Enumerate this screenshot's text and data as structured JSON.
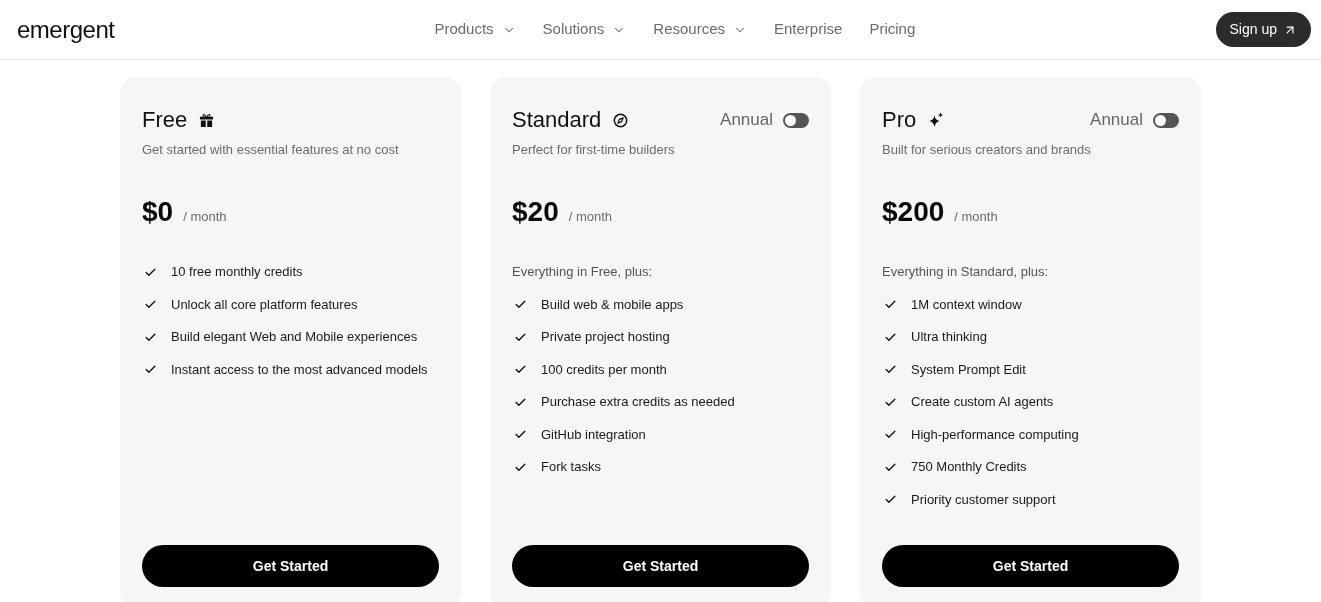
{
  "header": {
    "logo": "emergent",
    "nav": [
      {
        "label": "Products",
        "dropdown": true
      },
      {
        "label": "Solutions",
        "dropdown": true
      },
      {
        "label": "Resources",
        "dropdown": true
      },
      {
        "label": "Enterprise",
        "dropdown": false
      },
      {
        "label": "Pricing",
        "dropdown": false
      }
    ],
    "signup": "Sign up"
  },
  "plans": [
    {
      "name": "Free",
      "description": "Get started with essential features at no cost",
      "price": "$0",
      "period": "/ month",
      "features": [
        "10 free monthly credits",
        "Unlock all core platform features",
        "Build elegant Web and Mobile experiences",
        "Instant access to the most advanced models"
      ],
      "button": "Get Started"
    },
    {
      "name": "Standard",
      "annual": {
        "label": "Annual",
        "on": false
      },
      "description": "Perfect for first-time builders",
      "price": "$20",
      "period": "/ month",
      "includes": "Everything in Free, plus:",
      "features": [
        "Build web & mobile apps",
        "Private project hosting",
        "100 credits per month",
        "Purchase extra credits as needed",
        "GitHub integration",
        "Fork tasks"
      ],
      "button": "Get Started"
    },
    {
      "name": "Pro",
      "annual": {
        "label": "Annual",
        "on": false
      },
      "description": "Built for serious creators and brands",
      "price": "$200",
      "period": "/ month",
      "includes": "Everything in Standard, plus:",
      "features": [
        "1M context window",
        "Ultra thinking",
        "System Prompt Edit",
        "Create custom AI agents",
        "High-performance computing",
        "750 Monthly Credits",
        "Priority customer support"
      ],
      "button": "Get Started"
    }
  ]
}
